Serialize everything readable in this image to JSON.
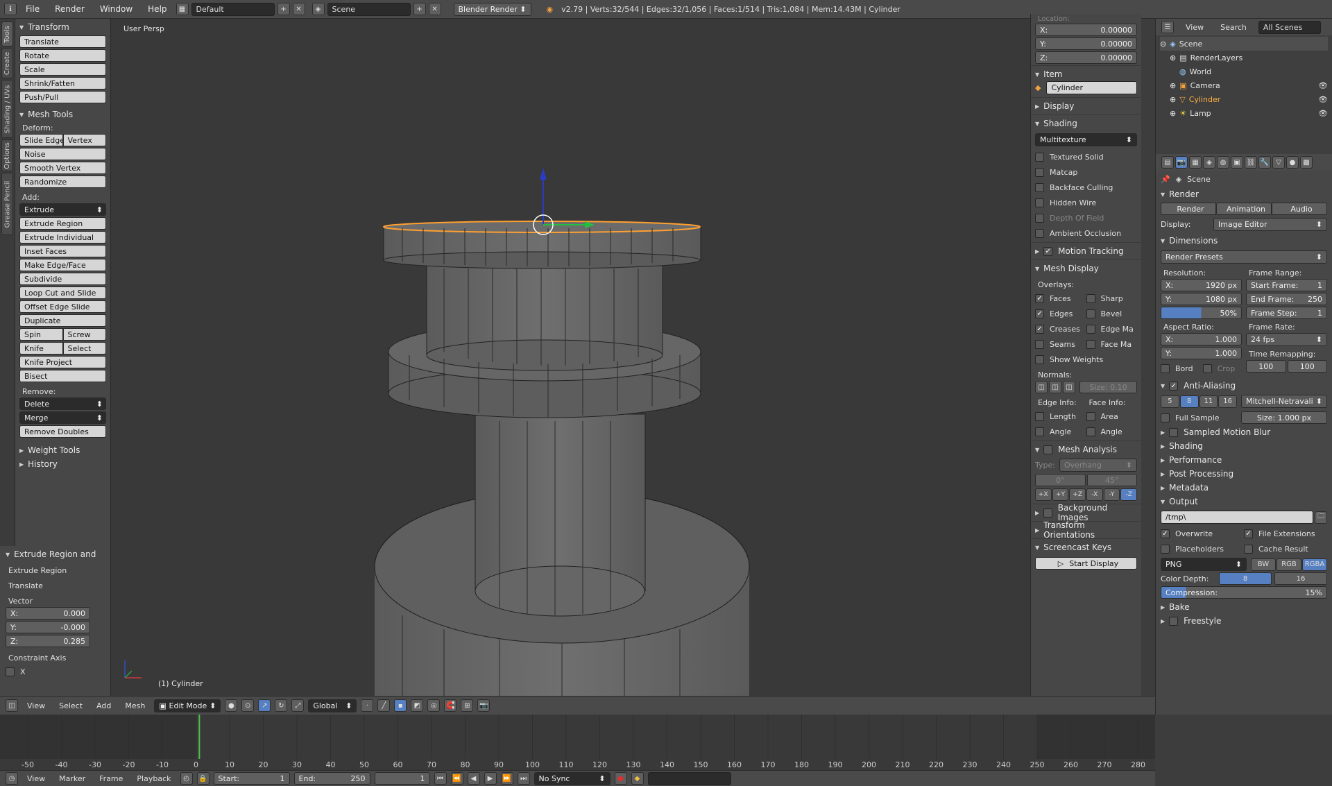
{
  "topbar": {
    "menus": [
      "File",
      "Render",
      "Window",
      "Help"
    ],
    "layout": "Default",
    "scene": "Scene",
    "engine": "Blender Render",
    "stats": "v2.79 | Verts:32/544 | Edges:32/1,056 | Faces:1/514 | Tris:1,084 | Mem:14.43M | Cylinder"
  },
  "tabs": [
    "Tools",
    "Create",
    "Shading / UVs",
    "Options",
    "Grease Pencil"
  ],
  "toolshelf": {
    "transform_title": "Transform",
    "transform": [
      "Translate",
      "Rotate",
      "Scale",
      "Shrink/Fatten",
      "Push/Pull"
    ],
    "meshtools_title": "Mesh Tools",
    "deform_label": "Deform:",
    "slide_edge": "Slide Edge",
    "vertex": "Vertex",
    "deform": [
      "Noise",
      "Smooth Vertex",
      "Randomize"
    ],
    "add_label": "Add:",
    "extrude": "Extrude",
    "add": [
      "Extrude Region",
      "Extrude Individual",
      "Inset Faces",
      "Make Edge/Face",
      "Subdivide",
      "Loop Cut and Slide",
      "Offset Edge Slide",
      "Duplicate"
    ],
    "spin": "Spin",
    "screw": "Screw",
    "knife": "Knife",
    "select": "Select",
    "knife_project": "Knife Project",
    "bisect": "Bisect",
    "remove_label": "Remove:",
    "delete": "Delete",
    "merge": "Merge",
    "remove_doubles": "Remove Doubles",
    "weight_tools": "Weight Tools",
    "history": "History"
  },
  "operator": {
    "title": "Extrude Region and",
    "extrude_region": "Extrude Region",
    "translate": "Translate",
    "vector": "Vector",
    "x_label": "X:",
    "x": "0.000",
    "y_label": "Y:",
    "y": "-0.000",
    "z_label": "Z:",
    "z": "0.285",
    "constraint": "Constraint Axis",
    "cx": "X"
  },
  "viewport": {
    "persp": "User Persp",
    "object": "(1) Cylinder"
  },
  "npanel": {
    "location": "Location:",
    "lx_label": "X:",
    "lx": "0.00000",
    "ly_label": "Y:",
    "ly": "0.00000",
    "lz_label": "Z:",
    "lz": "0.00000",
    "item": "Item",
    "item_name": "Cylinder",
    "display": "Display",
    "shading": "Shading",
    "shading_mode": "Multitexture",
    "shading_opts": [
      "Textured Solid",
      "Matcap",
      "Backface Culling",
      "Hidden Wire",
      "Depth Of Field",
      "Ambient Occlusion"
    ],
    "motion_tracking": "Motion Tracking",
    "mesh_display": "Mesh Display",
    "overlays": "Overlays:",
    "ov_left": [
      "Faces",
      "Edges",
      "Creases",
      "Seams"
    ],
    "ov_right": [
      "Sharp",
      "Bevel",
      "Edge Ma",
      "Face Ma"
    ],
    "show_weights": "Show Weights",
    "normals": "Normals:",
    "normals_size": "Size:  0.10",
    "edge_info": "Edge Info:",
    "face_info": "Face Info:",
    "length": "Length",
    "area": "Area",
    "angle": "Angle",
    "angle2": "Angle",
    "mesh_analysis": "Mesh Analysis",
    "type_label": "Type:",
    "type": "Overhang",
    "range_min": "0°",
    "range_max": "45°",
    "axes": [
      "+X",
      "+Y",
      "+Z",
      "-X",
      "-Y",
      "-Z"
    ],
    "bg_images": "Background Images",
    "transform_orient": "Transform Orientations",
    "screencast": "Screencast Keys",
    "start_display": "Start Display"
  },
  "outliner": {
    "view": "View",
    "search": "Search",
    "scenes": "All Scenes",
    "items": [
      "Scene",
      "RenderLayers",
      "World",
      "Camera",
      "Cylinder",
      "Lamp"
    ]
  },
  "props": {
    "scene": "Scene",
    "render_title": "Render",
    "render_btn": "Render",
    "animation_btn": "Animation",
    "audio_btn": "Audio",
    "display_label": "Display:",
    "display_val": "Image Editor",
    "dimensions": "Dimensions",
    "presets": "Render Presets",
    "resolution": "Resolution:",
    "frame_range": "Frame Range:",
    "res_x": "1920 px",
    "res_y": "1080 px",
    "res_pct": "50%",
    "start_frame": "Start Frame:",
    "start_frame_v": "1",
    "end_frame": "End Frame:",
    "end_frame_v": "250",
    "frame_step": "Frame Step:",
    "frame_step_v": "1",
    "aspect": "Aspect Ratio:",
    "frame_rate": "Frame Rate:",
    "asp_x": "1.000",
    "asp_y": "1.000",
    "fps": "24 fps",
    "bord": "Bord",
    "crop": "Crop",
    "time_remap": "Time Remapping:",
    "remap_old": "100",
    "remap_new": "100",
    "anti_aliasing": "Anti-Aliasing",
    "aa_samples": [
      "5",
      "8",
      "11",
      "16"
    ],
    "aa_filter": "Mitchell-Netravali",
    "full_sample": "Full Sample",
    "aa_size": "Size:   1.000 px",
    "collapsed": [
      "Sampled Motion Blur",
      "Shading",
      "Performance",
      "Post Processing",
      "Metadata"
    ],
    "output": "Output",
    "output_path": "/tmp\\",
    "overwrite": "Overwrite",
    "file_ext": "File Extensions",
    "placeholders": "Placeholders",
    "cache_result": "Cache Result",
    "format": "PNG",
    "bw": "BW",
    "rgb": "RGB",
    "rgba": "RGBA",
    "color_depth": "Color Depth:",
    "cd8": "8",
    "cd16": "16",
    "compression": "Compression:",
    "compression_v": "15%",
    "bake": "Bake",
    "freestyle": "Freestyle"
  },
  "vhead": {
    "menus": [
      "View",
      "Select",
      "Add",
      "Mesh"
    ],
    "mode": "Edit Mode",
    "orientation": "Global"
  },
  "timeline": {
    "ticks": [
      "-50",
      "-40",
      "-30",
      "-20",
      "-10",
      "0",
      "10",
      "20",
      "30",
      "40",
      "50",
      "60",
      "70",
      "80",
      "90",
      "100",
      "110",
      "120",
      "130",
      "140",
      "150",
      "160",
      "170",
      "180",
      "190",
      "200",
      "210",
      "220",
      "230",
      "240",
      "250",
      "260",
      "270",
      "280"
    ],
    "menus": [
      "View",
      "Marker",
      "Frame",
      "Playback"
    ],
    "start_label": "Start:",
    "start": "1",
    "end_label": "End:",
    "end": "250",
    "current": "1",
    "sync": "No Sync"
  },
  "colors": {
    "accent": "#5680c2",
    "selected_edge": "#ffa030",
    "current_frame": "#4cc24c"
  }
}
